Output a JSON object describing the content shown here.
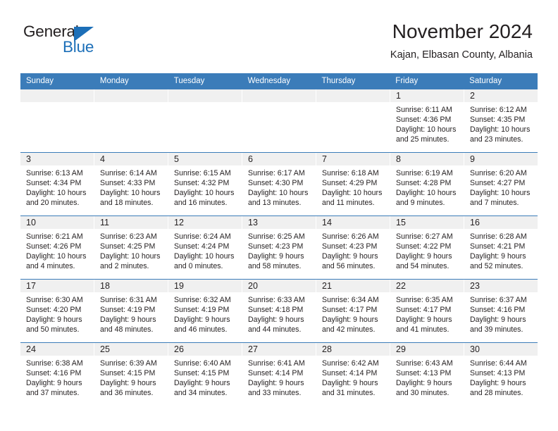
{
  "brand": {
    "name_part1": "General",
    "name_part2": "Blue",
    "accent_color": "#1c6fb8"
  },
  "header": {
    "title": "November 2024",
    "subtitle": "Kajan, Elbasan County, Albania"
  },
  "calendar": {
    "header_bg": "#3b7cb9",
    "daynum_bg": "#f0f0f0",
    "weekdays": [
      "Sunday",
      "Monday",
      "Tuesday",
      "Wednesday",
      "Thursday",
      "Friday",
      "Saturday"
    ],
    "weeks": [
      [
        {
          "day": "",
          "sunrise": "",
          "sunset": "",
          "daylight_line1": "",
          "daylight_line2": ""
        },
        {
          "day": "",
          "sunrise": "",
          "sunset": "",
          "daylight_line1": "",
          "daylight_line2": ""
        },
        {
          "day": "",
          "sunrise": "",
          "sunset": "",
          "daylight_line1": "",
          "daylight_line2": ""
        },
        {
          "day": "",
          "sunrise": "",
          "sunset": "",
          "daylight_line1": "",
          "daylight_line2": ""
        },
        {
          "day": "",
          "sunrise": "",
          "sunset": "",
          "daylight_line1": "",
          "daylight_line2": ""
        },
        {
          "day": "1",
          "sunrise": "Sunrise: 6:11 AM",
          "sunset": "Sunset: 4:36 PM",
          "daylight_line1": "Daylight: 10 hours",
          "daylight_line2": "and 25 minutes."
        },
        {
          "day": "2",
          "sunrise": "Sunrise: 6:12 AM",
          "sunset": "Sunset: 4:35 PM",
          "daylight_line1": "Daylight: 10 hours",
          "daylight_line2": "and 23 minutes."
        }
      ],
      [
        {
          "day": "3",
          "sunrise": "Sunrise: 6:13 AM",
          "sunset": "Sunset: 4:34 PM",
          "daylight_line1": "Daylight: 10 hours",
          "daylight_line2": "and 20 minutes."
        },
        {
          "day": "4",
          "sunrise": "Sunrise: 6:14 AM",
          "sunset": "Sunset: 4:33 PM",
          "daylight_line1": "Daylight: 10 hours",
          "daylight_line2": "and 18 minutes."
        },
        {
          "day": "5",
          "sunrise": "Sunrise: 6:15 AM",
          "sunset": "Sunset: 4:32 PM",
          "daylight_line1": "Daylight: 10 hours",
          "daylight_line2": "and 16 minutes."
        },
        {
          "day": "6",
          "sunrise": "Sunrise: 6:17 AM",
          "sunset": "Sunset: 4:30 PM",
          "daylight_line1": "Daylight: 10 hours",
          "daylight_line2": "and 13 minutes."
        },
        {
          "day": "7",
          "sunrise": "Sunrise: 6:18 AM",
          "sunset": "Sunset: 4:29 PM",
          "daylight_line1": "Daylight: 10 hours",
          "daylight_line2": "and 11 minutes."
        },
        {
          "day": "8",
          "sunrise": "Sunrise: 6:19 AM",
          "sunset": "Sunset: 4:28 PM",
          "daylight_line1": "Daylight: 10 hours",
          "daylight_line2": "and 9 minutes."
        },
        {
          "day": "9",
          "sunrise": "Sunrise: 6:20 AM",
          "sunset": "Sunset: 4:27 PM",
          "daylight_line1": "Daylight: 10 hours",
          "daylight_line2": "and 7 minutes."
        }
      ],
      [
        {
          "day": "10",
          "sunrise": "Sunrise: 6:21 AM",
          "sunset": "Sunset: 4:26 PM",
          "daylight_line1": "Daylight: 10 hours",
          "daylight_line2": "and 4 minutes."
        },
        {
          "day": "11",
          "sunrise": "Sunrise: 6:23 AM",
          "sunset": "Sunset: 4:25 PM",
          "daylight_line1": "Daylight: 10 hours",
          "daylight_line2": "and 2 minutes."
        },
        {
          "day": "12",
          "sunrise": "Sunrise: 6:24 AM",
          "sunset": "Sunset: 4:24 PM",
          "daylight_line1": "Daylight: 10 hours",
          "daylight_line2": "and 0 minutes."
        },
        {
          "day": "13",
          "sunrise": "Sunrise: 6:25 AM",
          "sunset": "Sunset: 4:23 PM",
          "daylight_line1": "Daylight: 9 hours",
          "daylight_line2": "and 58 minutes."
        },
        {
          "day": "14",
          "sunrise": "Sunrise: 6:26 AM",
          "sunset": "Sunset: 4:23 PM",
          "daylight_line1": "Daylight: 9 hours",
          "daylight_line2": "and 56 minutes."
        },
        {
          "day": "15",
          "sunrise": "Sunrise: 6:27 AM",
          "sunset": "Sunset: 4:22 PM",
          "daylight_line1": "Daylight: 9 hours",
          "daylight_line2": "and 54 minutes."
        },
        {
          "day": "16",
          "sunrise": "Sunrise: 6:28 AM",
          "sunset": "Sunset: 4:21 PM",
          "daylight_line1": "Daylight: 9 hours",
          "daylight_line2": "and 52 minutes."
        }
      ],
      [
        {
          "day": "17",
          "sunrise": "Sunrise: 6:30 AM",
          "sunset": "Sunset: 4:20 PM",
          "daylight_line1": "Daylight: 9 hours",
          "daylight_line2": "and 50 minutes."
        },
        {
          "day": "18",
          "sunrise": "Sunrise: 6:31 AM",
          "sunset": "Sunset: 4:19 PM",
          "daylight_line1": "Daylight: 9 hours",
          "daylight_line2": "and 48 minutes."
        },
        {
          "day": "19",
          "sunrise": "Sunrise: 6:32 AM",
          "sunset": "Sunset: 4:19 PM",
          "daylight_line1": "Daylight: 9 hours",
          "daylight_line2": "and 46 minutes."
        },
        {
          "day": "20",
          "sunrise": "Sunrise: 6:33 AM",
          "sunset": "Sunset: 4:18 PM",
          "daylight_line1": "Daylight: 9 hours",
          "daylight_line2": "and 44 minutes."
        },
        {
          "day": "21",
          "sunrise": "Sunrise: 6:34 AM",
          "sunset": "Sunset: 4:17 PM",
          "daylight_line1": "Daylight: 9 hours",
          "daylight_line2": "and 42 minutes."
        },
        {
          "day": "22",
          "sunrise": "Sunrise: 6:35 AM",
          "sunset": "Sunset: 4:17 PM",
          "daylight_line1": "Daylight: 9 hours",
          "daylight_line2": "and 41 minutes."
        },
        {
          "day": "23",
          "sunrise": "Sunrise: 6:37 AM",
          "sunset": "Sunset: 4:16 PM",
          "daylight_line1": "Daylight: 9 hours",
          "daylight_line2": "and 39 minutes."
        }
      ],
      [
        {
          "day": "24",
          "sunrise": "Sunrise: 6:38 AM",
          "sunset": "Sunset: 4:16 PM",
          "daylight_line1": "Daylight: 9 hours",
          "daylight_line2": "and 37 minutes."
        },
        {
          "day": "25",
          "sunrise": "Sunrise: 6:39 AM",
          "sunset": "Sunset: 4:15 PM",
          "daylight_line1": "Daylight: 9 hours",
          "daylight_line2": "and 36 minutes."
        },
        {
          "day": "26",
          "sunrise": "Sunrise: 6:40 AM",
          "sunset": "Sunset: 4:15 PM",
          "daylight_line1": "Daylight: 9 hours",
          "daylight_line2": "and 34 minutes."
        },
        {
          "day": "27",
          "sunrise": "Sunrise: 6:41 AM",
          "sunset": "Sunset: 4:14 PM",
          "daylight_line1": "Daylight: 9 hours",
          "daylight_line2": "and 33 minutes."
        },
        {
          "day": "28",
          "sunrise": "Sunrise: 6:42 AM",
          "sunset": "Sunset: 4:14 PM",
          "daylight_line1": "Daylight: 9 hours",
          "daylight_line2": "and 31 minutes."
        },
        {
          "day": "29",
          "sunrise": "Sunrise: 6:43 AM",
          "sunset": "Sunset: 4:13 PM",
          "daylight_line1": "Daylight: 9 hours",
          "daylight_line2": "and 30 minutes."
        },
        {
          "day": "30",
          "sunrise": "Sunrise: 6:44 AM",
          "sunset": "Sunset: 4:13 PM",
          "daylight_line1": "Daylight: 9 hours",
          "daylight_line2": "and 28 minutes."
        }
      ]
    ]
  }
}
